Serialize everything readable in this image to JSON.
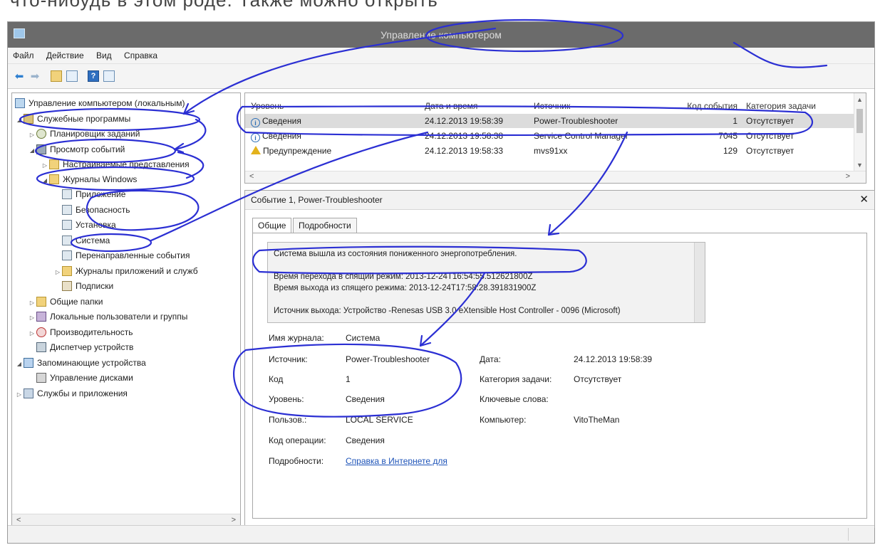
{
  "window": {
    "title": "Управление компьютером",
    "menu": [
      "Файл",
      "Действие",
      "Вид",
      "Справка"
    ]
  },
  "toolbar": {
    "icons": [
      "back-arrow-icon",
      "forward-arrow-icon",
      "up-folder-icon",
      "show-hide-tree-icon",
      "help-icon",
      "show-hide-action-pane-icon"
    ]
  },
  "tree": {
    "items": [
      {
        "label": "Управление компьютером (локальным)"
      },
      {
        "label": "Служебные программы"
      },
      {
        "label": "Планировщик заданий"
      },
      {
        "label": "Просмотр событий"
      },
      {
        "label": "Настраиваемые представления"
      },
      {
        "label": "Журналы Windows"
      },
      {
        "label": "Приложение"
      },
      {
        "label": "Безопасность"
      },
      {
        "label": "Установка"
      },
      {
        "label": "Система"
      },
      {
        "label": "Перенаправленные события"
      },
      {
        "label": "Журналы приложений и служб"
      },
      {
        "label": "Подписки"
      },
      {
        "label": "Общие папки"
      },
      {
        "label": "Локальные пользователи и группы"
      },
      {
        "label": "Производительность"
      },
      {
        "label": "Диспетчер устройств"
      },
      {
        "label": "Запоминающие устройства"
      },
      {
        "label": "Управление дисками"
      },
      {
        "label": "Службы и приложения"
      }
    ]
  },
  "events": {
    "columns": [
      "Уровень",
      "Дата и время",
      "Источник",
      "Код события",
      "Категория задачи"
    ],
    "rows": [
      {
        "level": "Сведения",
        "datetime": "24.12.2013 19:58:39",
        "source": "Power-Troubleshooter",
        "code": "1",
        "category": "Отсутствует"
      },
      {
        "level": "Сведения",
        "datetime": "24.12.2013 19:58:38",
        "source": "Service Control Manager",
        "code": "7045",
        "category": "Отсутствует"
      },
      {
        "level": "Предупреждение",
        "datetime": "24.12.2013 19:58:33",
        "source": "mvs91xx",
        "code": "129",
        "category": "Отсутствует"
      }
    ]
  },
  "detail": {
    "header": "Событие 1, Power-Troubleshooter",
    "tabs": [
      "Общие",
      "Подробности"
    ],
    "message": {
      "line1": "Система вышла из состояния пониженного энергопотребления.",
      "line2": "Время перехода в спящий режим: 2013-12-24T16:54:55.512621800Z",
      "line3": "Время выхода из спящего режима: 2013-12-24T17:58:28.391831900Z",
      "line4": "Источник выхода: Устройство -Renesas USB 3.0 eXtensible Host Controller - 0096 (Microsoft)"
    },
    "fields": {
      "log_name_label": "Имя журнала:",
      "log_name": "Система",
      "source_label": "Источник:",
      "source": "Power-Troubleshooter",
      "code_label": "Код",
      "code": "1",
      "level_label": "Уровень:",
      "level": "Сведения",
      "user_label": "Пользов.:",
      "user": "LOCAL SERVICE",
      "opcode_label": "Код операции:",
      "opcode": "Сведения",
      "details_label": "Подробности:",
      "details_link": "Справка в Интернете для",
      "date_label": "Дата:",
      "date": "24.12.2013 19:58:39",
      "category_label": "Категория задачи:",
      "category": "Отсутствует",
      "keywords_label": "Ключевые слова:",
      "computer_label": "Компьютер:",
      "computer": "VitoTheMan"
    }
  },
  "annotation": {
    "ink_color": "#2b2fd3",
    "cutoff_text": "что-нибудь в этом роде. Также можно открыть"
  }
}
